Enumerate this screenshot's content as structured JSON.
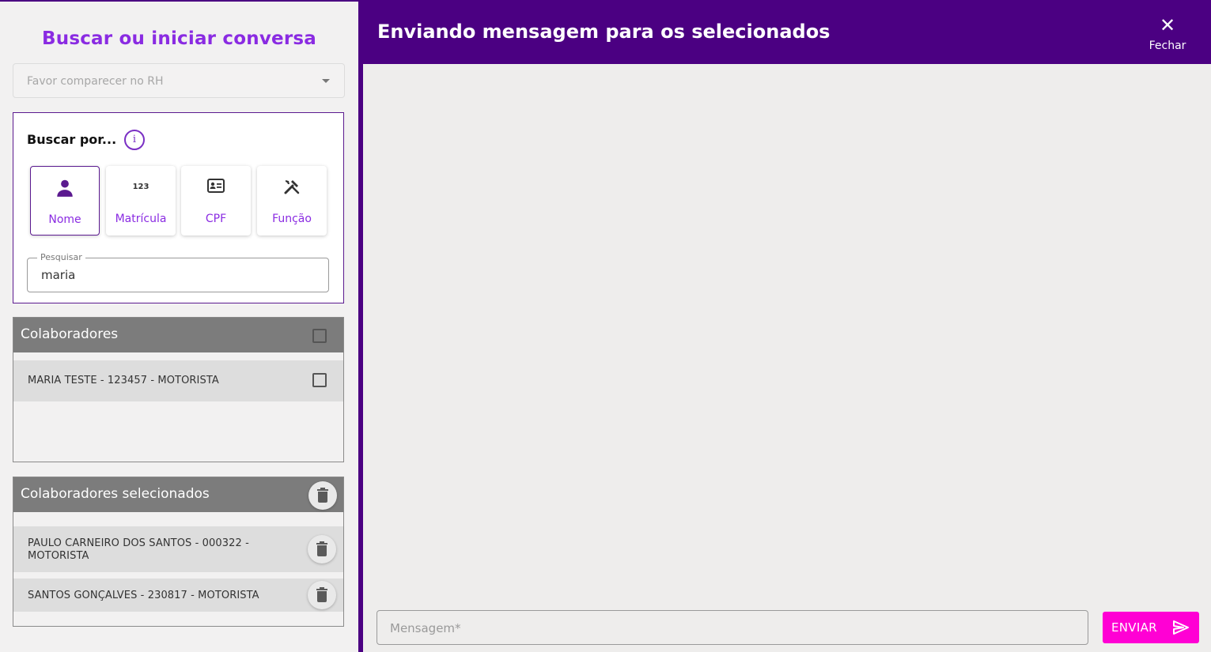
{
  "sidebar": {
    "title": "Buscar ou iniciar conversa",
    "template_select": {
      "value": "Favor comparecer no RH"
    },
    "search": {
      "label": "Buscar por...",
      "options": [
        {
          "label": "Nome",
          "icon": "person-icon",
          "active": true
        },
        {
          "label": "Matrícula",
          "icon": "numbers-icon",
          "active": false
        },
        {
          "label": "CPF",
          "icon": "id-card-icon",
          "active": false
        },
        {
          "label": "Função",
          "icon": "tools-icon",
          "active": false
        }
      ],
      "field_label": "Pesquisar",
      "field_value": "maria"
    },
    "collaborators": {
      "title": "Colaboradores",
      "rows": [
        {
          "text": "MARIA TESTE - 123457 - MOTORISTA"
        }
      ]
    },
    "selected": {
      "title": "Colaboradores selecionados",
      "rows": [
        {
          "text_line1": "PAULO CARNEIRO DOS SANTOS - 000322 -",
          "text_line2": "MOTORISTA"
        },
        {
          "text_line1": "SANTOS GONÇALVES - 230817 - MOTORISTA"
        }
      ]
    }
  },
  "main": {
    "header_title": "Enviando mensagem para os selecionados",
    "close_label": "Fechar",
    "message_placeholder": "Mensagem*",
    "send_label": "ENVIAR"
  },
  "colors": {
    "primary": "#4b0082",
    "accent": "#8a2be2",
    "send": "#ff00d4"
  }
}
